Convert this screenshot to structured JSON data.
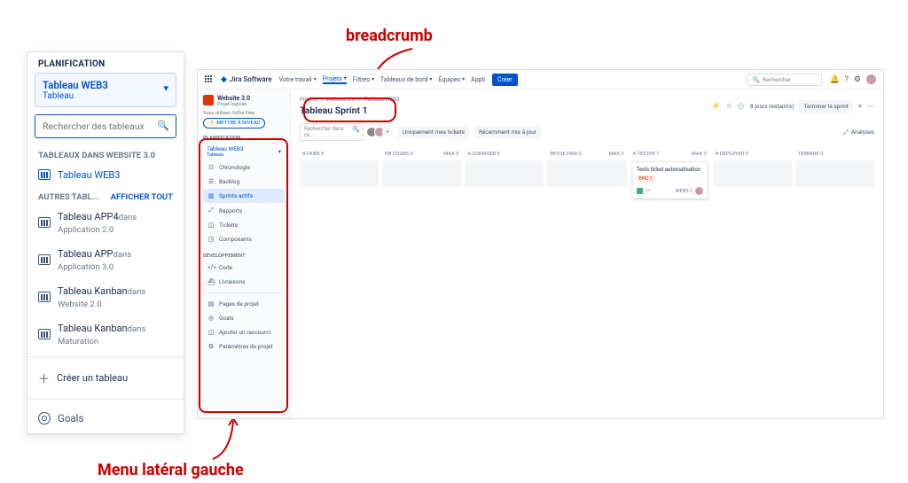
{
  "annotations": {
    "top": "breadcrumb",
    "bottom": "Menu latéral gauche"
  },
  "float_panel": {
    "section": "PLANIFICATION",
    "selector": {
      "title": "Tableau WEB3",
      "sub": "Tableau"
    },
    "search_placeholder": "Rechercher des tableaux",
    "group1_title": "TABLEAUX DANS WEBSITE 3.0",
    "board_current": "Tableau WEB3",
    "group2_title": "AUTRES TABL...",
    "show_all": "AFFICHER TOUT",
    "others": [
      {
        "name": "Tableau APP4",
        "sub": "dans Application 2.0"
      },
      {
        "name": "Tableau APP",
        "sub": "dans Application 3.0"
      },
      {
        "name": "Tableau Kanban",
        "sub": "dans Website 2.0"
      },
      {
        "name": "Tableau Kanban",
        "sub": "dans Maturation"
      }
    ],
    "create": "Créer un tableau",
    "goals": "Goals"
  },
  "jira": {
    "brand": "Jira Software",
    "nav": {
      "work": "Votre travail",
      "projects": "Projets",
      "filters": "Filtres",
      "dashboards": "Tableaux de bord",
      "teams": "Équipes",
      "apps": "Appli"
    },
    "create": "Créer",
    "search_placeholder": "Rechercher",
    "sidebar": {
      "project_name": "Website 3.0",
      "project_type": "Projet logiciel",
      "free_note": "Vous utilisez l'offre Free",
      "upgrade": "METTRE À NIVEAU",
      "sec_plan": "PLANIFICATION",
      "board_sel": {
        "title": "Tableau WEB3",
        "sub": "Tableau"
      },
      "items_plan": [
        "Chronologie",
        "Backlog",
        "Sprints actifs",
        "Rapports",
        "Tickets",
        "Composants"
      ],
      "sec_dev": "DÉVELOPPEMENT",
      "items_dev": [
        "Code",
        "Livraisons"
      ],
      "items_other": [
        "Pages de projet",
        "Goals",
        "Ajouter un raccourci",
        "Paramètres du projet"
      ]
    },
    "content": {
      "crumbs": [
        "Projets",
        "Website 3.0",
        "Tableau WEB3"
      ],
      "title": "Tableau Sprint 1",
      "days_left": "8 jours restant(s)",
      "terminate": "Terminer le sprint",
      "filter_search": "Rechercher dans ce ...",
      "only_mine": "Uniquement mes tickets",
      "recent": "Récemment mis à jour",
      "analyses": "Analyses",
      "columns": [
        {
          "name": "A FAIRE",
          "count": "0",
          "max": ""
        },
        {
          "name": "EN COURS",
          "count": "0",
          "max": "Max 5"
        },
        {
          "name": "A CORRIGER",
          "count": "0",
          "max": ""
        },
        {
          "name": "REVUE PAIR",
          "count": "0",
          "max": "Max 3"
        },
        {
          "name": "A TESTER",
          "count": "1",
          "max": "Max 3"
        },
        {
          "name": "A DÉPLOYER",
          "count": "0",
          "max": ""
        },
        {
          "name": "TERMINÉ",
          "count": "0",
          "max": ""
        }
      ],
      "card": {
        "title": "Tests ticket automatisation",
        "epic": "EPIC 1",
        "key": "WEB3-1"
      }
    }
  }
}
